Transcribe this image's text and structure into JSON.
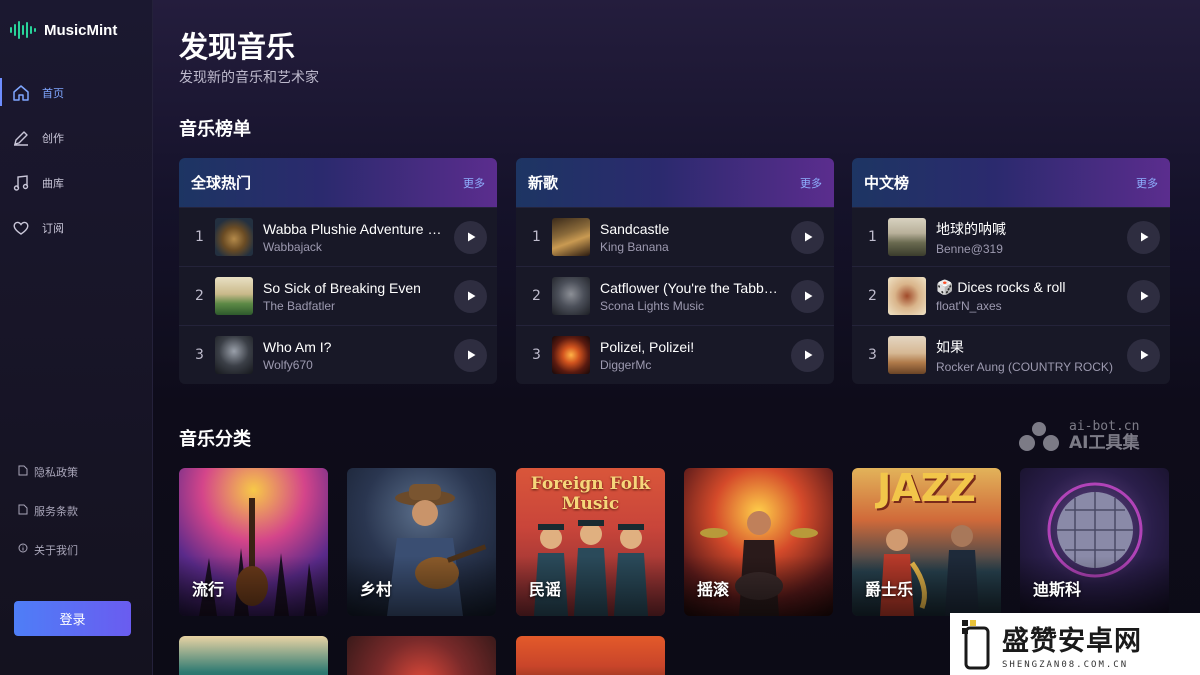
{
  "app": {
    "name": "MusicMint",
    "brand_color": "#29d39a",
    "accent_color": "#6e8dff"
  },
  "sidebar": {
    "nav": [
      {
        "label": "首页",
        "icon": "home-icon",
        "active": true
      },
      {
        "label": "创作",
        "icon": "pen-icon",
        "active": false
      },
      {
        "label": "曲库",
        "icon": "music-note-icon",
        "active": false
      },
      {
        "label": "订阅",
        "icon": "heart-icon",
        "active": false
      }
    ],
    "footer_links": [
      {
        "label": "隐私政策",
        "icon": "document-icon"
      },
      {
        "label": "服务条款",
        "icon": "document-icon"
      },
      {
        "label": "关于我们",
        "icon": "info-icon"
      }
    ],
    "login_label": "登录"
  },
  "main": {
    "title": "发现音乐",
    "subtitle": "发现新的音乐和艺术家",
    "charts_section_title": "音乐榜单",
    "genres_section_title": "音乐分类",
    "charts": [
      {
        "title": "全球热门",
        "more_label": "更多",
        "tracks": [
          {
            "rank": "1",
            "title": "Wabba Plushie Adventure Island",
            "artist": "Wabbajack"
          },
          {
            "rank": "2",
            "title": "So Sick of Breaking Even",
            "artist": "The Badfatler"
          },
          {
            "rank": "3",
            "title": "Who Am I?",
            "artist": "Wolfy670"
          }
        ]
      },
      {
        "title": "新歌",
        "more_label": "更多",
        "tracks": [
          {
            "rank": "1",
            "title": "Sandcastle",
            "artist": "King Banana"
          },
          {
            "rank": "2",
            "title": "Catflower (You're the Tabby Cat)",
            "artist": "Scona Lights Music"
          },
          {
            "rank": "3",
            "title": "Polizei, Polizei!",
            "artist": "DiggerMc"
          }
        ]
      },
      {
        "title": "中文榜",
        "more_label": "更多",
        "tracks": [
          {
            "rank": "1",
            "title": "地球的呐喊",
            "artist": "Benne@319"
          },
          {
            "rank": "2",
            "title": "🎲 Dices rocks & roll",
            "artist": "float'N_axes"
          },
          {
            "rank": "3",
            "title": "如果",
            "artist": "Rocker Aung (COUNTRY ROCK)"
          }
        ]
      }
    ],
    "genres": [
      {
        "label": "流行"
      },
      {
        "label": "乡村"
      },
      {
        "label": "民谣",
        "banner": "Foreign Folk Music"
      },
      {
        "label": "摇滚"
      },
      {
        "label": "爵士乐",
        "banner": "JAZZ"
      },
      {
        "label": "迪斯科"
      }
    ]
  },
  "watermarks": {
    "top": {
      "domain": "ai-bot.cn",
      "name": "AI工具集"
    },
    "bottom": {
      "name": "盛赞安卓网",
      "domain": "SHENGZAN08.COM.CN"
    }
  }
}
